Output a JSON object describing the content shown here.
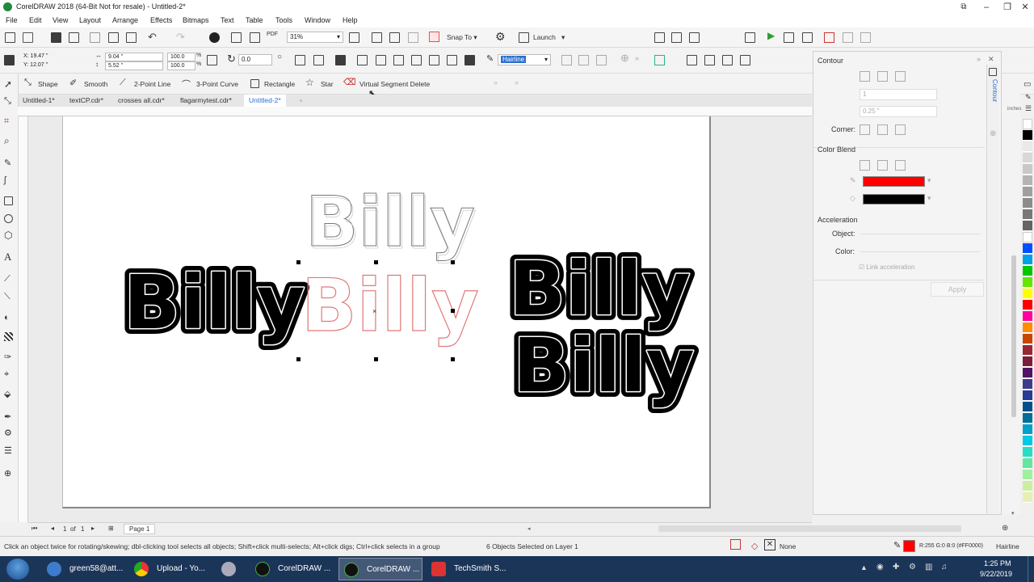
{
  "window": {
    "title": "CorelDRAW 2018 (64-Bit Not for resale) - Untitled-2*"
  },
  "menu": [
    "File",
    "Edit",
    "View",
    "Layout",
    "Arrange",
    "Effects",
    "Bitmaps",
    "Text",
    "Table",
    "Tools",
    "Window",
    "Help"
  ],
  "standard_toolbar": {
    "pdf": "PDF",
    "zoom": "31%",
    "snap_to": "Snap To",
    "launch": "Launch"
  },
  "property_bar": {
    "x": "X: 19.47 \"",
    "y": "Y: 12.07 \"",
    "width": "9.04 \"",
    "height": "5.52 \"",
    "scale_w": "100.0",
    "scale_h": "100.0",
    "pct": "%",
    "rotation": "0.0",
    "outline_width": "Hairline"
  },
  "tool_property_bar": {
    "shape": "Shape",
    "smooth": "Smooth",
    "two_point_line": "2-Point Line",
    "three_point_curve": "3-Point Curve",
    "rectangle": "Rectangle",
    "star": "Star",
    "virtual_segment_delete": "Virtual Segment Delete"
  },
  "doc_tabs": [
    "Untitled-1*",
    "textCP.cdr*",
    "crosses all.cdr*",
    "flagarmytest.cdr*",
    "Untitled-2*"
  ],
  "canvas": {
    "word": "Billy"
  },
  "page_nav": {
    "current": "1",
    "of": "of",
    "total": "1",
    "page_tab": "Page 1"
  },
  "docker": {
    "title": "Contour",
    "tab": "Contour",
    "steps": "1",
    "offset": "0.25 \"",
    "corner": "Corner:",
    "color_blend": "Color Blend",
    "outline_color": "#ff0000",
    "fill_color": "#000000",
    "acceleration": "Acceleration",
    "object": "Object:",
    "color": "Color:",
    "link": "Link acceleration",
    "apply": "Apply"
  },
  "ruler_units": "inches",
  "palette": [
    "#ffffff",
    "#000000",
    "#e8e8e8",
    "#d8d8d8",
    "#c8c8c8",
    "#b4b4b4",
    "#a0a0a0",
    "#8c8c8c",
    "#787878",
    "#646464",
    "#ffffff",
    "#0050ff",
    "#00a0e6",
    "#00c800",
    "#64e600",
    "#ffff00",
    "#ff0000",
    "#ff00a0",
    "#ff8c00",
    "#c84600",
    "#962832",
    "#7a1e3c",
    "#501464",
    "#3c3c8c",
    "#283c96",
    "#00508c",
    "#006e96",
    "#00a0c8",
    "#00c8e6",
    "#28dcc8",
    "#64e6a0",
    "#a0f0a0",
    "#c8f0a0",
    "#e6f0b4"
  ],
  "status": {
    "hint": "Click an object twice for rotating/skewing; dbl-clicking tool selects all objects; Shift+click multi-selects; Alt+click digs; Ctrl+click selects in a group",
    "selection": "6 Objects Selected on Layer 1",
    "fill": "None",
    "outline_info": "R:255 G:0 B:0 (#FF0000)",
    "outline_width": "Hairline",
    "outline_swatch": "#ff0000"
  },
  "taskbar": {
    "items": [
      "green58@att...",
      "Upload - Yo...",
      "",
      "CorelDRAW ...",
      "CorelDRAW ...",
      "TechSmith S..."
    ],
    "time": "1:25 PM",
    "date": "9/22/2019"
  }
}
